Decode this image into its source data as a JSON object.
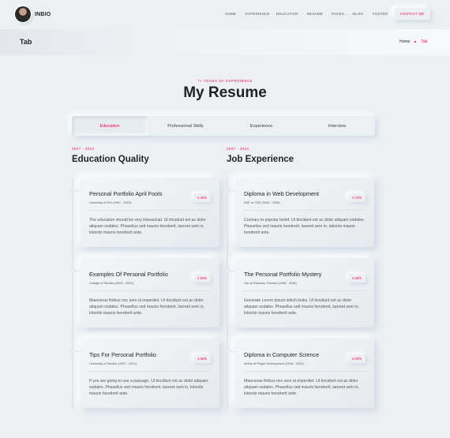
{
  "header": {
    "brand": "INBIO",
    "nav": [
      "HOME",
      "EXPERIENCE",
      "EDUCATION",
      "RESUME",
      "PAGES",
      "BLOG",
      "FOOTER"
    ],
    "pages_caret": "⌄",
    "contact_label": "CONTACT ME"
  },
  "titlebar": {
    "title": "Tab",
    "crumb_home": "Home",
    "crumb_current": "Tab"
  },
  "section": {
    "subtitle": "7+ YEARS OF EXPERIENCE",
    "title": "My Resume"
  },
  "tabs": [
    "Education",
    "Professional Skills",
    "Experience",
    "Interview"
  ],
  "left": {
    "years": "2007 - 2010",
    "heading": "Education Quality",
    "items": [
      {
        "title": "Personal Portfolio April Fools",
        "meta": "University of DVI (1997 - 2001)",
        "rating": "4.30/5",
        "body": "The education should be very interactual. Ut tincidunt est ac dolor aliquam sodales. Phasellus sed mauris hendrerit, laoreet sem in, lobortis mauris hendrerit ante."
      },
      {
        "title": "Examples Of Personal Portfolio",
        "meta": "College of Studies (2000 - 2002)",
        "rating": "4.50/5",
        "body": "Maecenas finibus nec sem ut imperdiet. Ut tincidunt est ac dolor aliquam sodales. Phasellus sed mauris hendrerit, laoreet sem in, lobortis mauris hendrerit ante."
      },
      {
        "title": "Tips For Personal Portfolio",
        "meta": "University of Studies (1997 - 2001)",
        "rating": "4.80/5",
        "body": "If you are going to use a passage. Ut tincidunt est ac dolor aliquam sodales. Phasellus sed mauris hendrerit, laoreet sem in, lobortis mauris hendrerit ante."
      }
    ]
  },
  "right": {
    "years": "2007 - 2010",
    "heading": "Job Experience",
    "items": [
      {
        "title": "Diploma in Web Development",
        "meta": "BSE In CSE (2004 - 2008)",
        "rating": "4.70/5",
        "body": "Contrary to popular belief. Ut tincidunt est ac dolor aliquam sodales. Phasellus sed mauris hendrerit, laoreet sem in, lobortis mauris hendrerit ante."
      },
      {
        "title": "The Personal Portfolio Mystery",
        "meta": "Job at Rainbow-Themes (2008 - 2016)",
        "rating": "4.95/5",
        "body": "Generate Lorem Ipsum which looks. Ut tincidunt est ac dolor aliquam sodales. Phasellus sed mauris hendrerit, laoreet sem in, lobortis mauris hendrerit ante."
      },
      {
        "title": "Diploma in Computer Science",
        "meta": "Works at Plugin Development (2016 - 2020)",
        "rating": "5.00/5",
        "body": "Maecenas finibus nec sem ut imperdiet. Ut tincidunt est ac dolor aliquam sodales. Phasellus sed mauris hendrerit, laoreet sem in, lobortis mauris hendrerit ante."
      }
    ]
  }
}
